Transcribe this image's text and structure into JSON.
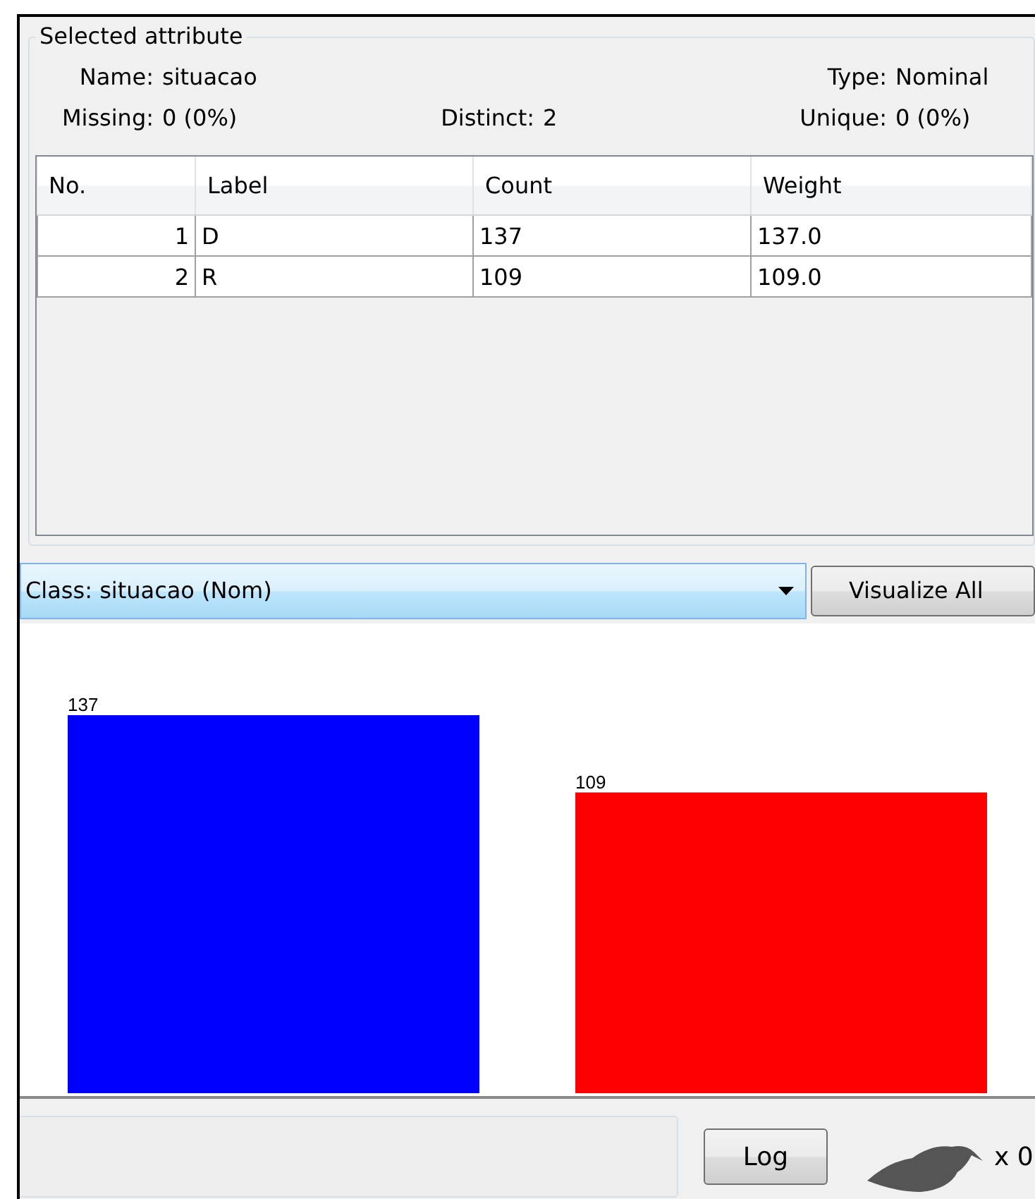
{
  "selected_attribute": {
    "title": "Selected attribute",
    "name_label": "Name:",
    "name": "situacao",
    "type_label": "Type:",
    "type": "Nominal",
    "missing_label": "Missing:",
    "missing": "0 (0%)",
    "distinct_label": "Distinct:",
    "distinct": "2",
    "unique_label": "Unique:",
    "unique": "0 (0%)"
  },
  "table": {
    "columns": [
      "No.",
      "Label",
      "Count",
      "Weight"
    ],
    "rows": [
      [
        "1",
        "D",
        "137",
        "137.0"
      ],
      [
        "2",
        "R",
        "109",
        "109.0"
      ]
    ]
  },
  "class_select": {
    "value": "Class: situacao (Nom)"
  },
  "visualize_button": "Visualize All",
  "chart_data": {
    "type": "bar",
    "data_labels": true,
    "categories": [
      null
    ],
    "series": [
      {
        "color": "#0000ff",
        "values": [
          137
        ]
      },
      {
        "color": "#ff0000",
        "values": [
          109
        ]
      }
    ]
  },
  "log_button": "Log",
  "status_count": "x 0"
}
